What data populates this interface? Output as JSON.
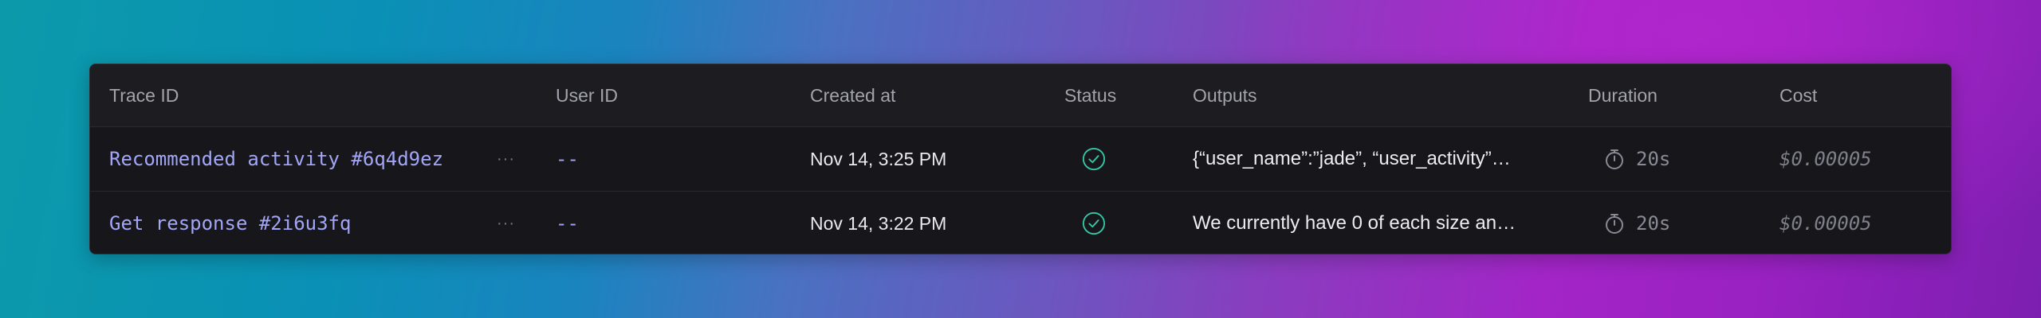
{
  "table": {
    "columns": {
      "trace_id": "Trace ID",
      "user_id": "User ID",
      "created_at": "Created at",
      "status": "Status",
      "outputs": "Outputs",
      "duration": "Duration",
      "cost": "Cost"
    },
    "rows": [
      {
        "trace_name": "Recommended activity #6q4d9ez",
        "more": "···",
        "user_id": "--",
        "created_at": "Nov 14, 3:25 PM",
        "status": "success",
        "status_icon": "check-circle-icon",
        "outputs": "{“user_name”:”jade”, “user_activity”…",
        "duration": "20s",
        "duration_icon": "stopwatch-icon",
        "cost": "$0.00005"
      },
      {
        "trace_name": "Get response #2i6u3fq",
        "more": "···",
        "user_id": "--",
        "created_at": "Nov 14, 3:22 PM",
        "status": "success",
        "status_icon": "check-circle-icon",
        "outputs": "We currently have 0 of each size an…",
        "duration": "20s",
        "duration_icon": "stopwatch-icon",
        "cost": "$0.00005"
      }
    ]
  },
  "colors": {
    "link": "#a3a6f7",
    "status_success": "#34c6a6",
    "panel_bg": "#17171b"
  }
}
